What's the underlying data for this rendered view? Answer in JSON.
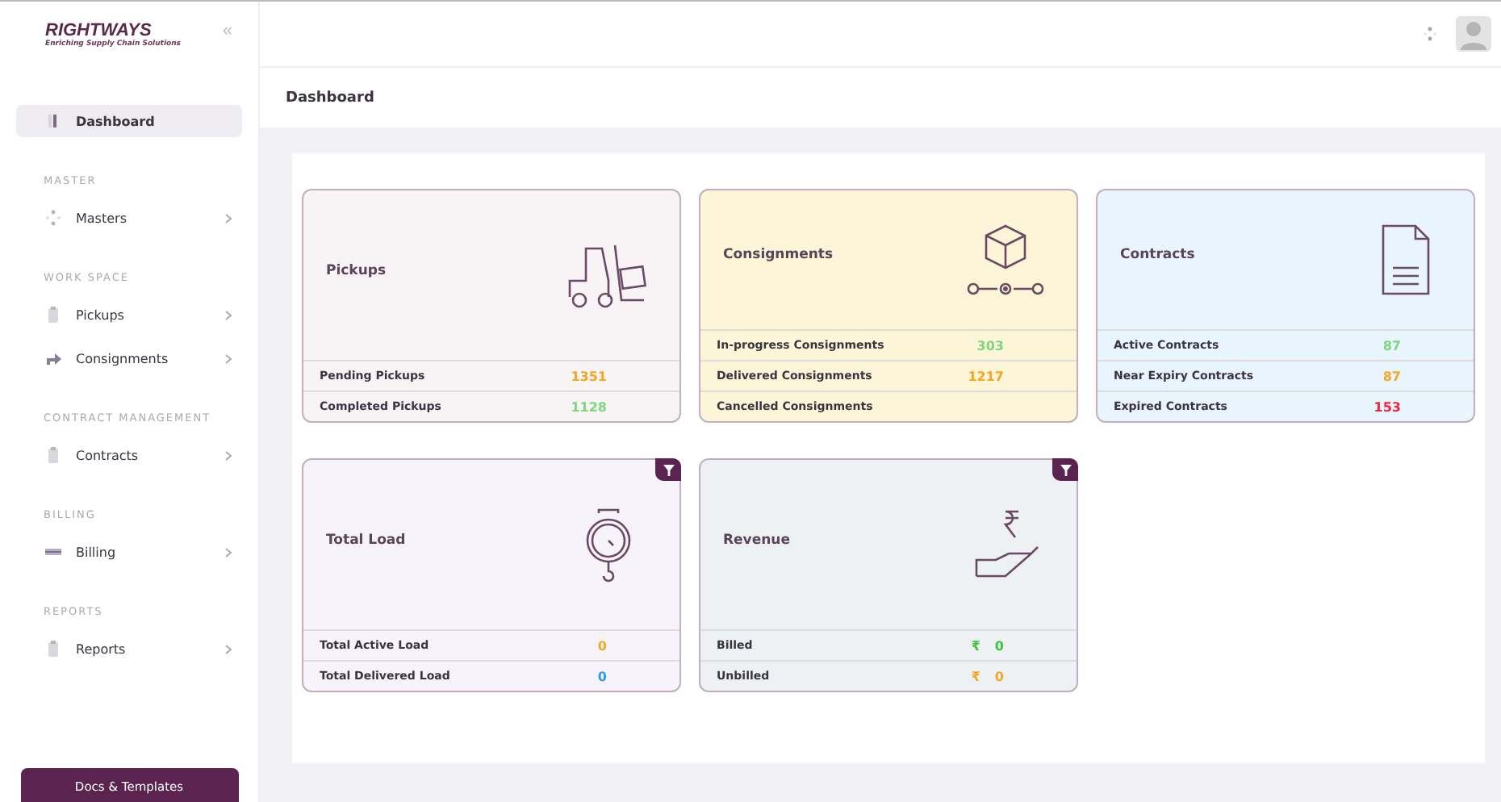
{
  "logo": {
    "name": "RIGHTWAYS",
    "tagline": "Enriching Supply Chain Solutions"
  },
  "collapse": "«",
  "sidebar": {
    "sections": [
      {
        "items": [
          {
            "label": "Dashboard",
            "selected": true,
            "chevron": false
          }
        ]
      },
      {
        "heading": "MASTER",
        "items": [
          {
            "label": "Masters",
            "selected": false,
            "chevron": true
          }
        ]
      },
      {
        "heading": "WORK SPACE",
        "items": [
          {
            "label": "Pickups",
            "selected": false,
            "chevron": true
          },
          {
            "label": "Consignments",
            "selected": false,
            "chevron": true
          }
        ]
      },
      {
        "heading": "CONTRACT MANAGEMENT",
        "items": [
          {
            "label": "Contracts",
            "selected": false,
            "chevron": true
          }
        ]
      },
      {
        "heading": "BILLING",
        "items": [
          {
            "label": "Billing",
            "selected": false,
            "chevron": true
          }
        ]
      },
      {
        "heading": "REPORTS",
        "items": [
          {
            "label": "Reports",
            "selected": false,
            "chevron": true
          }
        ]
      }
    ],
    "button": "Docs & Templates"
  },
  "page_title": "Dashboard",
  "cards": [
    {
      "title": "Pickups",
      "color": "#f8f4f6",
      "filter": false,
      "stats": [
        {
          "label": "Pending Pickups",
          "value": "1351",
          "color": "#f5a623"
        },
        {
          "label": "Completed Pickups",
          "value": "1128",
          "color": "#7ed67e"
        }
      ]
    },
    {
      "title": "Consignments",
      "color": "#fdf5d8",
      "filter": false,
      "stats": [
        {
          "label": "In-progress Consignments",
          "value": "303",
          "color": "#7ed67e"
        },
        {
          "label": "Delivered Consignments",
          "value": "1217",
          "color": "#f5a623"
        },
        {
          "label": "Cancelled Consignments"
        }
      ]
    },
    {
      "title": "Contracts",
      "color": "#e9f5fd",
      "filter": false,
      "stats": [
        {
          "label": "Active Contracts",
          "value": "87",
          "color": "#7ed67e"
        },
        {
          "label": "Near Expiry Contracts",
          "value": "87",
          "color": "#f5a623"
        },
        {
          "label": "Expired Contracts",
          "value": "153",
          "color": "#f0243a"
        }
      ]
    },
    {
      "title": "Total Load",
      "color": "#f6f3fb",
      "filter": true,
      "stats": [
        {
          "label": "Total Active Load",
          "value": "0",
          "color": "#f5a623"
        },
        {
          "label": "Total Delivered Load",
          "value": "0",
          "color": "#2e9be6"
        }
      ]
    },
    {
      "title": "Revenue",
      "color": "#edf1f4",
      "filter": true,
      "stats": [
        {
          "label": "Billed",
          "currency": "₹",
          "value": "0",
          "color": "#3cc43c"
        },
        {
          "label": "Unbilled",
          "currency": "₹",
          "value": "0",
          "color": "#f5a623"
        }
      ]
    }
  ]
}
